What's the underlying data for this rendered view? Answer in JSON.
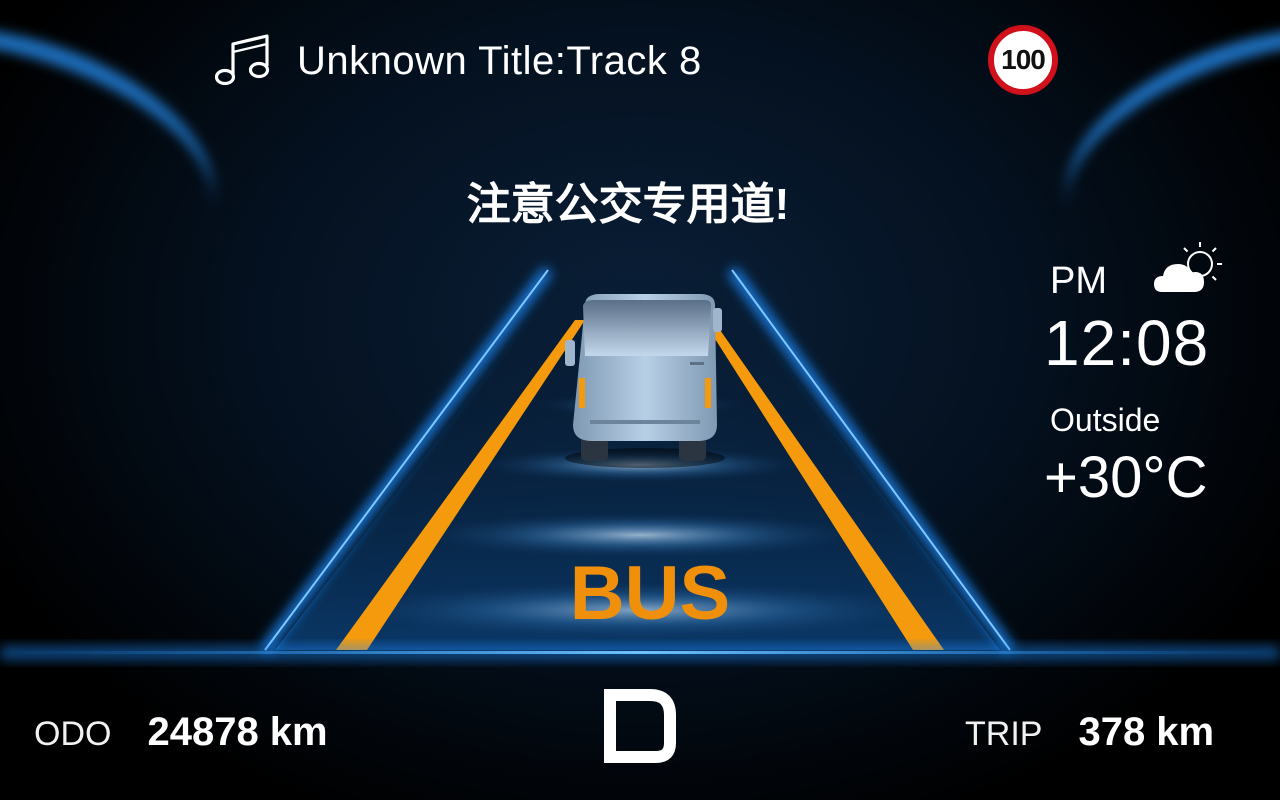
{
  "media": {
    "icon": "music-note-icon",
    "track_title": "Unknown Title:Track 8"
  },
  "speed_limit": {
    "value": "100",
    "border_color": "#d0101a"
  },
  "alert": {
    "message": "注意公交专用道!"
  },
  "clock": {
    "period": "PM",
    "time": "12:08",
    "weather_icon": "partly-cloudy-icon"
  },
  "temperature": {
    "label": "Outside",
    "value": "+30°C"
  },
  "lane": {
    "label": "BUS",
    "label_color": "#f0900a",
    "line_color": "#f59a0c",
    "edge_glow_color": "#1a8cff"
  },
  "odometer": {
    "label": "ODO",
    "value": "24878 km"
  },
  "trip": {
    "label": "TRIP",
    "value": "378 km"
  },
  "gear": {
    "icon": "gear-d-icon"
  }
}
